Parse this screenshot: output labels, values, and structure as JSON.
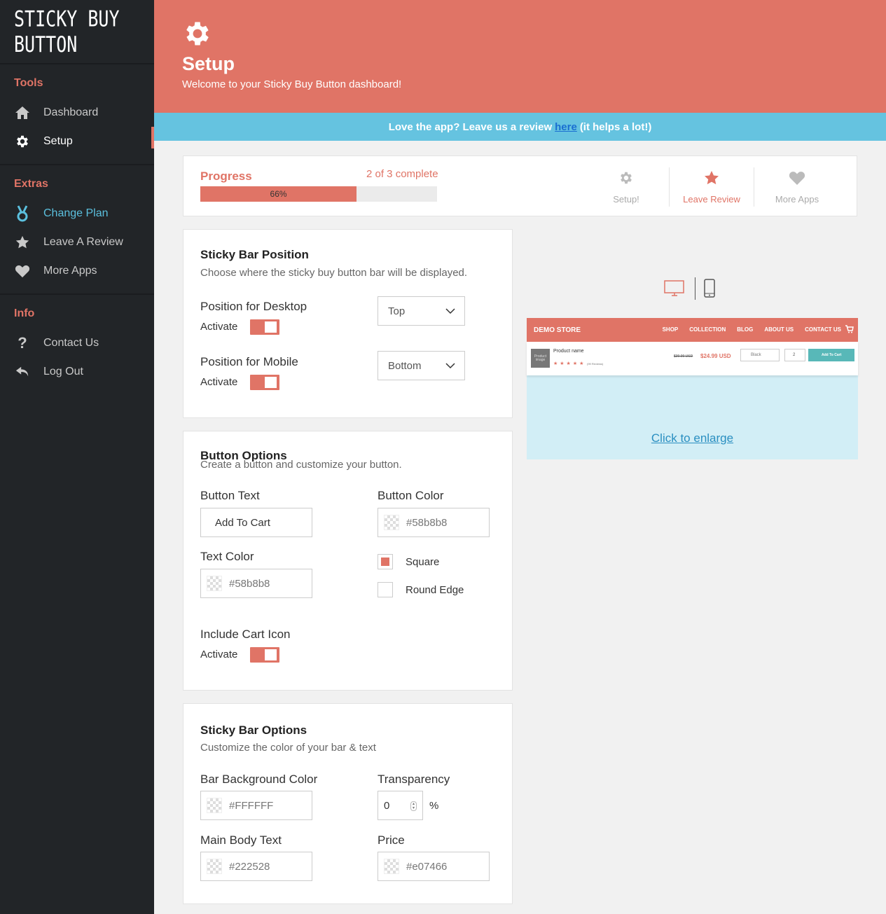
{
  "sidebar": {
    "logo": "STICKY BUY BUTTON",
    "sections": {
      "tools": "Tools",
      "extras": "Extras",
      "info": "Info"
    },
    "items": {
      "dashboard": "Dashboard",
      "setup": "Setup",
      "change_plan": "Change Plan",
      "leave_review": "Leave A Review",
      "more_apps": "More Apps",
      "contact_us": "Contact Us",
      "log_out": "Log Out"
    }
  },
  "header": {
    "title": "Setup",
    "subtitle": "Welcome to your Sticky Buy Button dashboard!"
  },
  "review_bar": {
    "before": "Love the app? Leave us a review",
    "link": "here",
    "after": "(it helps a lot!)"
  },
  "progress": {
    "label": "Progress",
    "count": "2 of 3 complete",
    "percent": 66,
    "percent_label": "66%",
    "steps": {
      "setup": "Setup!",
      "review": "Leave Review",
      "more": "More Apps"
    }
  },
  "position": {
    "title": "Sticky Bar Position",
    "subtitle": "Choose where the sticky buy button bar will be displayed.",
    "desktop_label": "Position for Desktop",
    "desktop_value": "Top",
    "mobile_label": "Position for Mobile",
    "mobile_value": "Bottom",
    "activate": "Activate"
  },
  "button_options": {
    "title": "Button Options",
    "subtitle": "Create a button and customize your button.",
    "text_label": "Button Text",
    "text_value": "Add To Cart",
    "color_label": "Button Color",
    "color_value": "#58b8b8",
    "text_color_label": "Text Color",
    "text_color_value": "#58b8b8",
    "square": "Square",
    "round": "Round Edge",
    "cart_icon_label": "Include Cart Icon",
    "activate": "Activate"
  },
  "bar_options": {
    "title": "Sticky Bar Options",
    "subtitle": "Customize the color of your bar & text",
    "bg_label": "Bar Background Color",
    "bg_value": "#FFFFFF",
    "transparency_label": "Transparency",
    "transparency_value": "0",
    "percent_sign": "%",
    "body_label": "Main Body Text",
    "body_value": "#222528",
    "price_label": "Price",
    "price_value": "#e07466"
  },
  "preview": {
    "store": "DEMO STORE",
    "nav": [
      "SHOP",
      "COLLECTION",
      "BLOG",
      "ABOUT US",
      "CONTACT US"
    ],
    "product_image": "Product image",
    "product_name": "Product name",
    "reviews": "(99 Reviews)",
    "old_price": "$39.99 USD",
    "price": "$24.99 USD",
    "variant": "Black",
    "qty": "2",
    "add_to_cart": "Add To Cart",
    "enlarge": "Click to enlarge"
  },
  "colors": {
    "accent": "#e07466",
    "sidebar": "#222528",
    "review_bar": "#65c3e0",
    "button": "#58b8b8"
  }
}
